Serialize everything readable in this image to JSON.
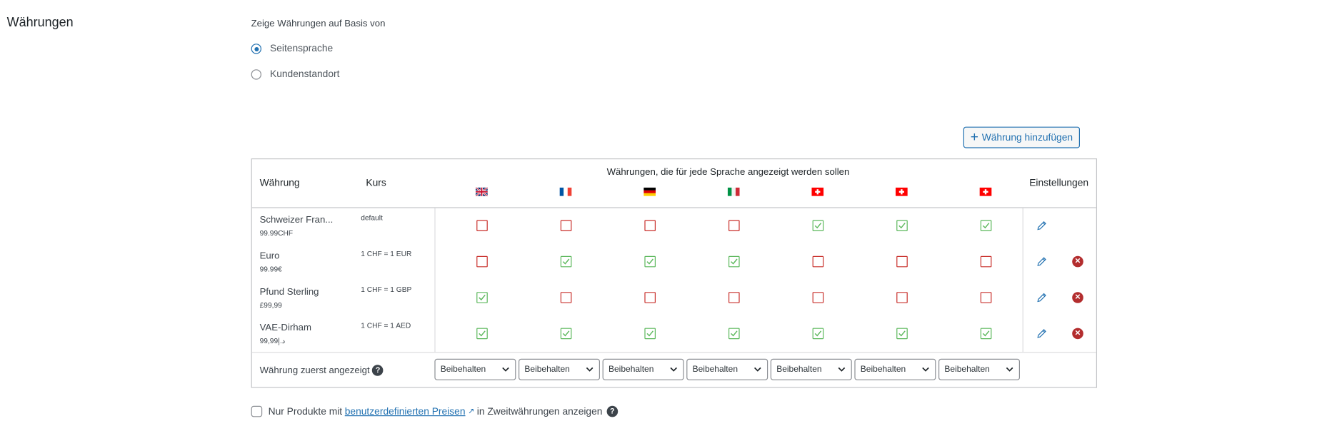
{
  "section_title": "Währungen",
  "basis": {
    "label": "Zeige Währungen auf Basis von",
    "options": [
      {
        "label": "Seitensprache",
        "checked": true
      },
      {
        "label": "Kundenstandort",
        "checked": false
      }
    ]
  },
  "add_button": "Währung hinzufügen",
  "table": {
    "col_currency": "Währung",
    "col_rate": "Kurs",
    "col_languages": "Währungen, die für jede Sprache angezeigt werden sollen",
    "col_settings": "Einstellungen",
    "languages": [
      "uk-flag",
      "fr-flag",
      "de-flag",
      "it-flag",
      "ch-flag",
      "ch-flag",
      "ch-flag"
    ],
    "rows": [
      {
        "name": "Schweizer Fran...",
        "sample": "99.99CHF",
        "rate": "default",
        "checks": [
          false,
          false,
          false,
          false,
          true,
          true,
          true
        ],
        "deletable": false
      },
      {
        "name": "Euro",
        "sample": "99.99€",
        "rate": "1 CHF = 1 EUR",
        "checks": [
          false,
          true,
          true,
          true,
          false,
          false,
          false
        ],
        "deletable": true
      },
      {
        "name": "Pfund Sterling",
        "sample": "£99,99",
        "rate": "1 CHF = 1 GBP",
        "checks": [
          true,
          false,
          false,
          false,
          false,
          false,
          false
        ],
        "deletable": true
      },
      {
        "name": "VAE-Dirham",
        "sample": "د.إ99,99",
        "rate": "1 CHF = 1 AED",
        "checks": [
          true,
          true,
          true,
          true,
          true,
          true,
          true
        ],
        "deletable": true
      }
    ],
    "first_shown_label": "Währung zuerst angezeigt",
    "first_shown_values": [
      "Beibehalten",
      "Beibehalten",
      "Beibehalten",
      "Beibehalten",
      "Beibehalten",
      "Beibehalten",
      "Beibehalten"
    ]
  },
  "bottom": {
    "text_before": "Nur Produkte mit",
    "link": "benutzerdefinierten Preisen",
    "text_after": "in Zweitwährungen anzeigen"
  },
  "colors": {
    "accent": "#2271b1",
    "checked": "#5cb85c",
    "unchecked": "#c9302c",
    "delete": "#b32d2e"
  }
}
